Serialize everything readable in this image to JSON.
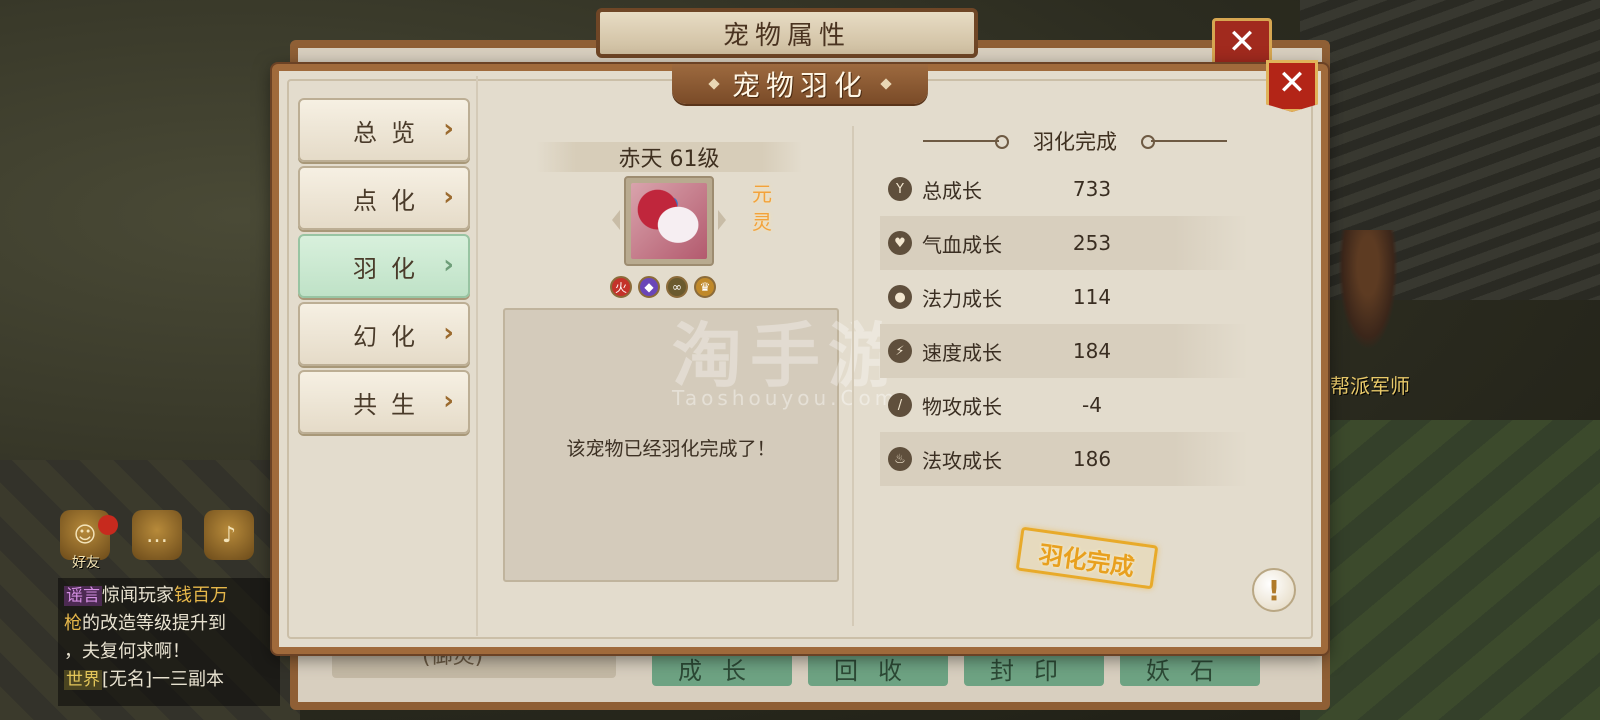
{
  "back_window": {
    "title": "宠物属性",
    "bottom_buttons": [
      "成长",
      "回收",
      "封印",
      "妖石"
    ],
    "left_field": "(御灵)",
    "close_glyph": "✕"
  },
  "window": {
    "title": "宠物羽化",
    "close_glyph": "✕"
  },
  "tabs": [
    {
      "label": "总览",
      "active": false
    },
    {
      "label": "点化",
      "active": false
    },
    {
      "label": "羽化",
      "active": true
    },
    {
      "label": "幻化",
      "active": false
    },
    {
      "label": "共生",
      "active": false
    }
  ],
  "pet": {
    "name_level": "赤天 61级",
    "tag_line1": "元",
    "tag_line2": "灵",
    "attributes": [
      {
        "icon": "fire-icon",
        "glyph": "火"
      },
      {
        "icon": "drop-icon",
        "glyph": "◆"
      },
      {
        "icon": "cloud-icon",
        "glyph": "∞"
      },
      {
        "icon": "crown-icon",
        "glyph": "♛"
      }
    ]
  },
  "message": "该宠物已经羽化完成了！",
  "watermark": {
    "main": "淘手游",
    "sub": "Taoshouyou.Com"
  },
  "stats": {
    "title": "羽化完成",
    "rows": [
      {
        "icon": "total-growth-icon",
        "glyph": "Y",
        "label": "总成长",
        "value": "733"
      },
      {
        "icon": "hp-growth-icon",
        "glyph": "♥",
        "label": "气血成长",
        "value": "253"
      },
      {
        "icon": "mp-growth-icon",
        "glyph": "●",
        "label": "法力成长",
        "value": "114"
      },
      {
        "icon": "speed-growth-icon",
        "glyph": "⚡",
        "label": "速度成长",
        "value": "184"
      },
      {
        "icon": "phys-attack-growth-icon",
        "glyph": "/",
        "label": "物攻成长",
        "value": "-4"
      },
      {
        "icon": "magic-attack-growth-icon",
        "glyph": "♨",
        "label": "法攻成长",
        "value": "186"
      }
    ]
  },
  "stamp": "羽化完成",
  "info_glyph": "!",
  "scene": {
    "npc_name": "帮派军师",
    "friend_label": "好友",
    "chat": {
      "line1_tag": "谣言",
      "line1_text": "惊闻玩家",
      "line1_gold": "钱百万",
      "line2_gold": "枪",
      "line2_text": "的改造等级提升到",
      "line3_text": "，夫复何求啊！",
      "line4_tag": "世界",
      "line4_text": "[无名]一三副本"
    }
  },
  "colors": {
    "accent_brown": "#a06a3b",
    "active_tab_green": "#bfe2c7",
    "stamp_gold": "#e8a01f",
    "close_red": "#b32517"
  }
}
